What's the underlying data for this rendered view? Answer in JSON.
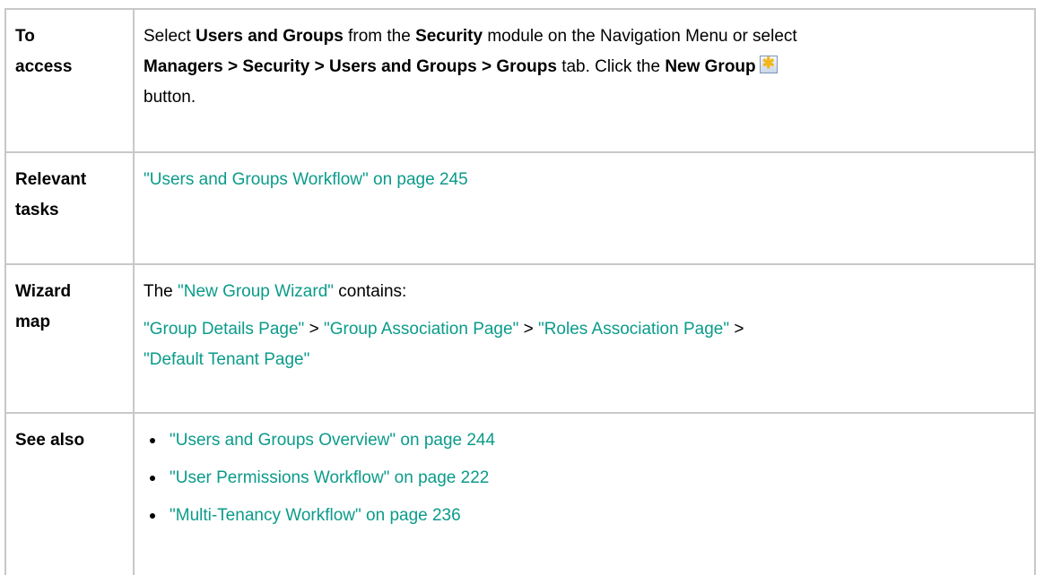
{
  "rows": {
    "access": {
      "label": [
        "To",
        "access"
      ],
      "line1": {
        "t1": "Select ",
        "b1": "Users and Groups",
        "t2": " from the ",
        "b2": "Security",
        "t3": " module on the Navigation Menu or select"
      },
      "line2": {
        "b1": "Managers > Security > Users and Groups > Groups",
        "t1": " tab. Click the ",
        "b2": "New Group"
      },
      "line3": "button.",
      "icon": "new-group-icon"
    },
    "tasks": {
      "label": [
        "Relevant",
        "tasks"
      ],
      "link": "\"Users and Groups Workflow\" on page 245"
    },
    "wizard": {
      "label": [
        "Wizard",
        "map"
      ],
      "intro": {
        "t1": "The ",
        "link": "\"New Group Wizard\"",
        "t2": " contains:"
      },
      "steps": {
        "s1": "\"Group Details Page\"",
        "sep1": " > ",
        "s2": "\"Group Association Page\"",
        "sep2": " > ",
        "s3": "\"Roles Association Page\"",
        "sep3": " >",
        "s4": "\"Default Tenant Page\""
      }
    },
    "see_also": {
      "label": "See also",
      "items": [
        "\"Users and Groups Overview\" on page 244",
        "\"User Permissions Workflow\" on page 222",
        "\"Multi-Tenancy Workflow\" on page 236"
      ]
    }
  },
  "colors": {
    "link": "#0b9b8a",
    "border": "#c8c8c8"
  }
}
